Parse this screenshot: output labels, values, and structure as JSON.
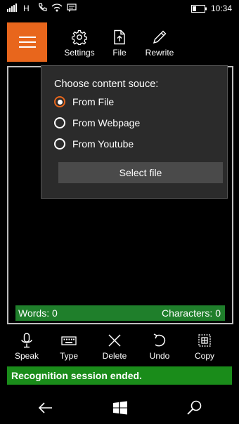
{
  "status_bar": {
    "network": "H",
    "time": "10:34"
  },
  "toolbar": {
    "settings_label": "Settings",
    "file_label": "File",
    "rewrite_label": "Rewrite"
  },
  "flyout": {
    "title": "Choose content souce:",
    "options": [
      {
        "label": "From File",
        "selected": true
      },
      {
        "label": "From Webpage",
        "selected": false
      },
      {
        "label": "From Youtube",
        "selected": false
      }
    ],
    "select_button": "Select file"
  },
  "counts": {
    "words": "Words: 0",
    "characters": "Characters: 0"
  },
  "commands": {
    "speak": "Speak",
    "type": "Type",
    "delete": "Delete",
    "undo": "Undo",
    "copy": "Copy"
  },
  "status_message": "Recognition session ended.",
  "colors": {
    "accent": "#e8661c",
    "count_bar": "#1f7f2b",
    "status_green": "#1a8c1a"
  }
}
